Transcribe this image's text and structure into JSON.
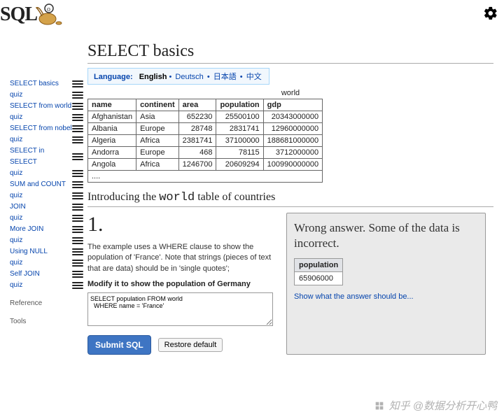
{
  "logo_text": "SQL",
  "page_title": "SELECT basics",
  "lang": {
    "label": "Language:",
    "current": "English",
    "options": [
      "Deutsch",
      "日本語",
      "中文"
    ]
  },
  "sidebar": {
    "items": [
      {
        "label": "SELECT basics",
        "burger": true
      },
      {
        "label": "quiz",
        "burger": true
      },
      {
        "label": "SELECT from world",
        "burger": true
      },
      {
        "label": "quiz",
        "burger": true
      },
      {
        "label": "SELECT from nobel",
        "burger": true
      },
      {
        "label": "quiz",
        "burger": true
      },
      {
        "label": "SELECT in SELECT",
        "burger": true
      },
      {
        "label": "quiz",
        "burger": true
      },
      {
        "label": "SUM and COUNT",
        "burger": true
      },
      {
        "label": "quiz",
        "burger": true
      },
      {
        "label": "JOIN",
        "burger": true
      },
      {
        "label": "quiz",
        "burger": true
      },
      {
        "label": "More JOIN",
        "burger": true
      },
      {
        "label": "quiz",
        "burger": true
      },
      {
        "label": "Using NULL",
        "burger": true
      },
      {
        "label": "quiz",
        "burger": true
      },
      {
        "label": "Self JOIN",
        "burger": true
      },
      {
        "label": "quiz",
        "burger": true
      }
    ],
    "reference": "Reference",
    "tools": "Tools"
  },
  "world_table": {
    "caption": "world",
    "headers": [
      "name",
      "continent",
      "area",
      "population",
      "gdp"
    ],
    "rows": [
      [
        "Afghanistan",
        "Asia",
        "652230",
        "25500100",
        "20343000000"
      ],
      [
        "Albania",
        "Europe",
        "28748",
        "2831741",
        "12960000000"
      ],
      [
        "Algeria",
        "Africa",
        "2381741",
        "37100000",
        "188681000000"
      ],
      [
        "Andorra",
        "Europe",
        "468",
        "78115",
        "3712000000"
      ],
      [
        "Angola",
        "Africa",
        "1246700",
        "20609294",
        "100990000000"
      ]
    ],
    "ellipsis": "...."
  },
  "intro_heading_pre": "Introducing the ",
  "intro_heading_code": "world",
  "intro_heading_post": " table of countries",
  "question": {
    "number": "1.",
    "text": "The example uses a WHERE clause to show the population of 'France'. Note that strings (pieces of text that are data) should be in 'single quotes';",
    "prompt": "Modify it to show the population of Germany",
    "sql": "SELECT population FROM world\n  WHERE name = 'France'",
    "submit_label": "Submit SQL",
    "restore_label": "Restore default"
  },
  "result": {
    "message": "Wrong answer. Some of the data is incorrect.",
    "header": "population",
    "value": "65906000",
    "show_link": "Show what the answer should be..."
  },
  "watermark": "知乎 @数据分析开心鸭"
}
